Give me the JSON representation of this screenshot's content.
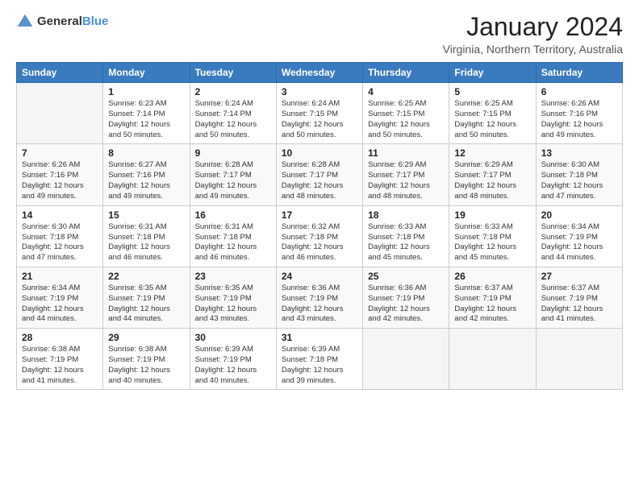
{
  "header": {
    "logo_general": "General",
    "logo_blue": "Blue",
    "title": "January 2024",
    "subtitle": "Virginia, Northern Territory, Australia"
  },
  "days_of_week": [
    "Sunday",
    "Monday",
    "Tuesday",
    "Wednesday",
    "Thursday",
    "Friday",
    "Saturday"
  ],
  "weeks": [
    [
      {
        "day": "",
        "info": ""
      },
      {
        "day": "1",
        "info": "Sunrise: 6:23 AM\nSunset: 7:14 PM\nDaylight: 12 hours\nand 50 minutes."
      },
      {
        "day": "2",
        "info": "Sunrise: 6:24 AM\nSunset: 7:14 PM\nDaylight: 12 hours\nand 50 minutes."
      },
      {
        "day": "3",
        "info": "Sunrise: 6:24 AM\nSunset: 7:15 PM\nDaylight: 12 hours\nand 50 minutes."
      },
      {
        "day": "4",
        "info": "Sunrise: 6:25 AM\nSunset: 7:15 PM\nDaylight: 12 hours\nand 50 minutes."
      },
      {
        "day": "5",
        "info": "Sunrise: 6:25 AM\nSunset: 7:15 PM\nDaylight: 12 hours\nand 50 minutes."
      },
      {
        "day": "6",
        "info": "Sunrise: 6:26 AM\nSunset: 7:16 PM\nDaylight: 12 hours\nand 49 minutes."
      }
    ],
    [
      {
        "day": "7",
        "info": "Sunrise: 6:26 AM\nSunset: 7:16 PM\nDaylight: 12 hours\nand 49 minutes."
      },
      {
        "day": "8",
        "info": "Sunrise: 6:27 AM\nSunset: 7:16 PM\nDaylight: 12 hours\nand 49 minutes."
      },
      {
        "day": "9",
        "info": "Sunrise: 6:28 AM\nSunset: 7:17 PM\nDaylight: 12 hours\nand 49 minutes."
      },
      {
        "day": "10",
        "info": "Sunrise: 6:28 AM\nSunset: 7:17 PM\nDaylight: 12 hours\nand 48 minutes."
      },
      {
        "day": "11",
        "info": "Sunrise: 6:29 AM\nSunset: 7:17 PM\nDaylight: 12 hours\nand 48 minutes."
      },
      {
        "day": "12",
        "info": "Sunrise: 6:29 AM\nSunset: 7:17 PM\nDaylight: 12 hours\nand 48 minutes."
      },
      {
        "day": "13",
        "info": "Sunrise: 6:30 AM\nSunset: 7:18 PM\nDaylight: 12 hours\nand 47 minutes."
      }
    ],
    [
      {
        "day": "14",
        "info": "Sunrise: 6:30 AM\nSunset: 7:18 PM\nDaylight: 12 hours\nand 47 minutes."
      },
      {
        "day": "15",
        "info": "Sunrise: 6:31 AM\nSunset: 7:18 PM\nDaylight: 12 hours\nand 46 minutes."
      },
      {
        "day": "16",
        "info": "Sunrise: 6:31 AM\nSunset: 7:18 PM\nDaylight: 12 hours\nand 46 minutes."
      },
      {
        "day": "17",
        "info": "Sunrise: 6:32 AM\nSunset: 7:18 PM\nDaylight: 12 hours\nand 46 minutes."
      },
      {
        "day": "18",
        "info": "Sunrise: 6:33 AM\nSunset: 7:18 PM\nDaylight: 12 hours\nand 45 minutes."
      },
      {
        "day": "19",
        "info": "Sunrise: 6:33 AM\nSunset: 7:18 PM\nDaylight: 12 hours\nand 45 minutes."
      },
      {
        "day": "20",
        "info": "Sunrise: 6:34 AM\nSunset: 7:19 PM\nDaylight: 12 hours\nand 44 minutes."
      }
    ],
    [
      {
        "day": "21",
        "info": "Sunrise: 6:34 AM\nSunset: 7:19 PM\nDaylight: 12 hours\nand 44 minutes."
      },
      {
        "day": "22",
        "info": "Sunrise: 6:35 AM\nSunset: 7:19 PM\nDaylight: 12 hours\nand 44 minutes."
      },
      {
        "day": "23",
        "info": "Sunrise: 6:35 AM\nSunset: 7:19 PM\nDaylight: 12 hours\nand 43 minutes."
      },
      {
        "day": "24",
        "info": "Sunrise: 6:36 AM\nSunset: 7:19 PM\nDaylight: 12 hours\nand 43 minutes."
      },
      {
        "day": "25",
        "info": "Sunrise: 6:36 AM\nSunset: 7:19 PM\nDaylight: 12 hours\nand 42 minutes."
      },
      {
        "day": "26",
        "info": "Sunrise: 6:37 AM\nSunset: 7:19 PM\nDaylight: 12 hours\nand 42 minutes."
      },
      {
        "day": "27",
        "info": "Sunrise: 6:37 AM\nSunset: 7:19 PM\nDaylight: 12 hours\nand 41 minutes."
      }
    ],
    [
      {
        "day": "28",
        "info": "Sunrise: 6:38 AM\nSunset: 7:19 PM\nDaylight: 12 hours\nand 41 minutes."
      },
      {
        "day": "29",
        "info": "Sunrise: 6:38 AM\nSunset: 7:19 PM\nDaylight: 12 hours\nand 40 minutes."
      },
      {
        "day": "30",
        "info": "Sunrise: 6:39 AM\nSunset: 7:19 PM\nDaylight: 12 hours\nand 40 minutes."
      },
      {
        "day": "31",
        "info": "Sunrise: 6:39 AM\nSunset: 7:18 PM\nDaylight: 12 hours\nand 39 minutes."
      },
      {
        "day": "",
        "info": ""
      },
      {
        "day": "",
        "info": ""
      },
      {
        "day": "",
        "info": ""
      }
    ]
  ]
}
